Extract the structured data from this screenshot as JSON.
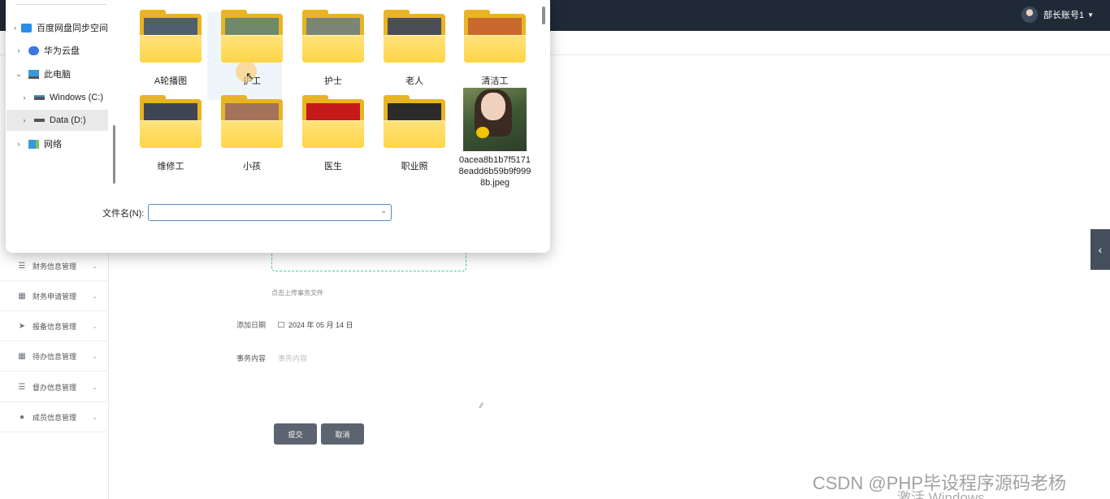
{
  "header": {
    "user_name": "部长账号1",
    "user_caret": "▼"
  },
  "sidebar": {
    "items": [
      {
        "label": "财务信息管理",
        "icon": "list-icon",
        "glyph": "☰"
      },
      {
        "label": "财务申请管理",
        "icon": "grid-icon",
        "glyph": "▦"
      },
      {
        "label": "报备信息管理",
        "icon": "send-icon",
        "glyph": "➤"
      },
      {
        "label": "待办信息管理",
        "icon": "apps-icon",
        "glyph": "▦"
      },
      {
        "label": "督办信息管理",
        "icon": "list-icon",
        "glyph": "☰"
      },
      {
        "label": "成员信息管理",
        "icon": "user-icon",
        "glyph": "●"
      }
    ]
  },
  "form": {
    "upload_tip": "点击上传事务文件",
    "date_label": "添加日期",
    "date_value": "2024 年 05 月 14 日",
    "content_label": "事务内容",
    "content_placeholder": "事务内容",
    "submit_label": "提交",
    "cancel_label": "取消"
  },
  "edge_tab": "‹",
  "watermark": "CSDN @PHP毕设程序源码老杨",
  "activate_text": "激活 Windows",
  "dialog": {
    "tree": [
      {
        "label": "百度网盘同步空间",
        "twisty": "›",
        "icon": "baidu-cloud-icon",
        "color": "#2a8de8"
      },
      {
        "label": "华为云盘",
        "twisty": "›",
        "icon": "huawei-cloud-icon",
        "color": "#3a78e0"
      },
      {
        "label": "此电脑",
        "twisty": "⌄",
        "icon": "this-pc-icon",
        "color": "#3a9ad9"
      },
      {
        "label": "Windows (C:)",
        "twisty": "›",
        "icon": "drive-c-icon",
        "color": "#555555"
      },
      {
        "label": "Data (D:)",
        "twisty": "›",
        "icon": "drive-d-icon",
        "color": "#555555"
      },
      {
        "label": "网络",
        "twisty": "›",
        "icon": "network-icon",
        "color": "#3a9ad9"
      }
    ],
    "folders": [
      {
        "label": "A轮播图",
        "thumb": "#4f5f6e"
      },
      {
        "label": "护工",
        "thumb": "#6f8a6a"
      },
      {
        "label": "护士",
        "thumb": "#7a8578"
      },
      {
        "label": "老人",
        "thumb": "#4a4e58"
      },
      {
        "label": "清洁工",
        "thumb": "#c86a2e"
      },
      {
        "label": "维修工",
        "thumb": "#3d4652"
      },
      {
        "label": "小孩",
        "thumb": "#a5735a"
      },
      {
        "label": "医生",
        "thumb": "#c41a1a"
      },
      {
        "label": "职业照",
        "thumb": "#2b2b2b"
      }
    ],
    "image_file": {
      "label": "0acea8b1b7f51718eadd6b59b9f9998b.jpeg"
    },
    "filename_label": "文件名(N):",
    "filename_value": ""
  }
}
